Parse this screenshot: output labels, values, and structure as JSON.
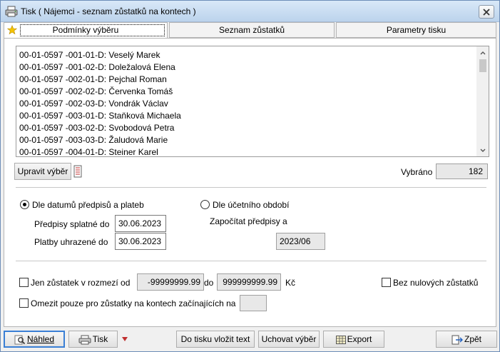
{
  "window": {
    "title": "Tisk ( Nájemci - seznam zůstatků na kontech )"
  },
  "tabs": [
    {
      "label": "Podmínky výběru",
      "active": true
    },
    {
      "label": "Seznam zůstatků",
      "active": false
    },
    {
      "label": "Parametry tisku",
      "active": false
    }
  ],
  "list": {
    "items": [
      "00-01-0597 -001-01-D: Veselý Marek",
      "00-01-0597 -001-02-D: Doležalová Elena",
      "00-01-0597 -002-01-D: Pejchal Roman",
      "00-01-0597 -002-02-D: Červenka Tomáš",
      "00-01-0597 -002-03-D: Vondrák Václav",
      "00-01-0597 -003-01-D: Staňková Michaela",
      "00-01-0597 -003-02-D: Svobodová Petra",
      "00-01-0597 -003-03-D: Žaludová Marie",
      "00-01-0597 -004-01-D: Steiner Karel"
    ]
  },
  "selection": {
    "edit_button": "Upravit výběr",
    "count_label": "Vybráno",
    "count_value": "182"
  },
  "dates": {
    "by_dates_label": "Dle datumů předpisů a plateb",
    "due_label": "Předpisy splatné do",
    "due_value": "30.06.2023",
    "paid_label": "Platby uhrazené do",
    "paid_value": "30.06.2023",
    "by_period_label": "Dle účetního období",
    "include_label": "Započítat předpisy a",
    "period_value": "2023/06"
  },
  "filters": {
    "range_label": "Jen zůstatek v rozmezí od",
    "range_from": "-99999999.99",
    "range_to_label": "do",
    "range_to": "999999999.99",
    "currency": "Kč",
    "no_zero_label": "Bez nulových zůstatků",
    "prefix_label": "Omezit pouze pro zůstatky na kontech začínajících na",
    "prefix_value": ""
  },
  "buttons": {
    "preview": "Náhled",
    "print": "Tisk",
    "insert_text": "Do tisku vložit text",
    "save_selection": "Uchovat výběr",
    "export": "Export",
    "back": "Zpět"
  }
}
